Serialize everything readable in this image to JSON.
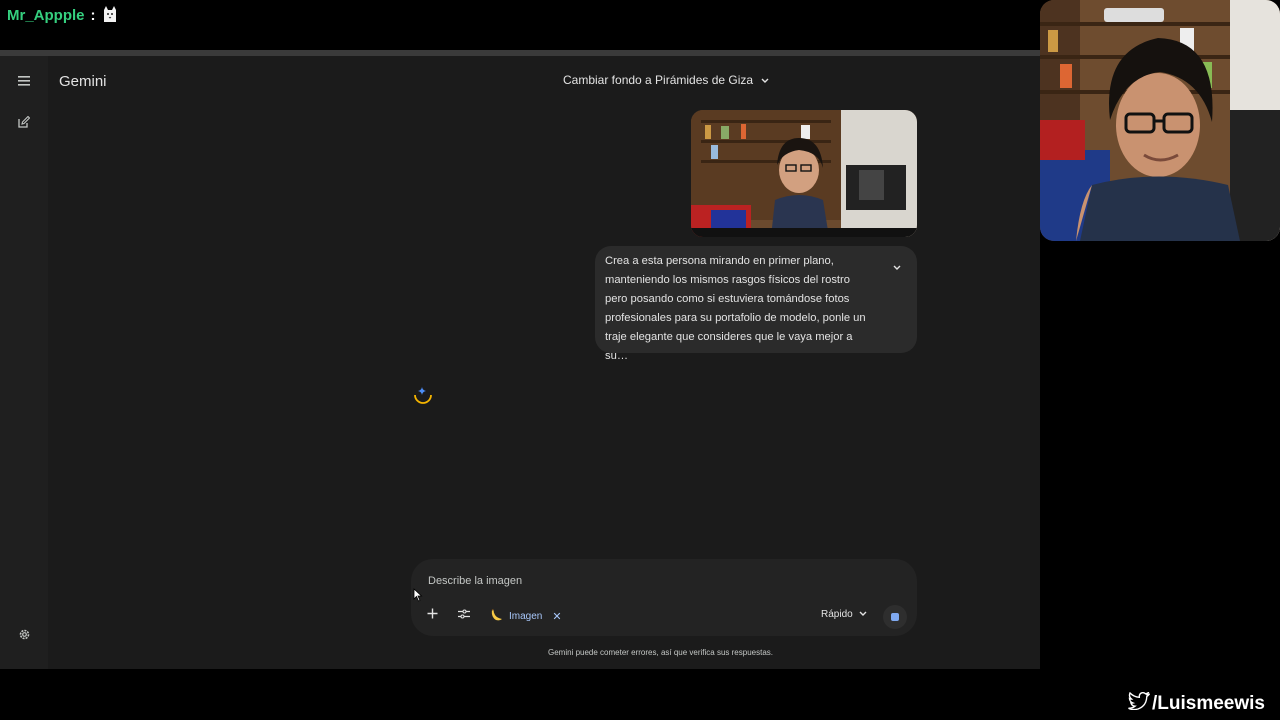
{
  "overlay": {
    "chat_user": "Mr_Appple",
    "chat_colon": ":",
    "social_handle": "/Luismeewis"
  },
  "app": {
    "brand": "Gemini",
    "conversation_title": "Cambiar fondo a Pirámides de Giza",
    "user_message": "Crea a esta persona mirando en primer plano, manteniendo los mismos rasgos físicos del rostro pero posando como si estuviera tomándose fotos profesionales para su portafolio de modelo, ponle un traje elegante que consideres que le vaya mejor a su…",
    "composer": {
      "placeholder": "Describe la imagen",
      "tool_chip_label": "Imagen",
      "model_label": "Rápido"
    },
    "disclaimer": "Gemini puede cometer errores, así que verifica sus respuestas."
  },
  "icons": {
    "menu": "menu-icon",
    "new_chat": "edit-icon",
    "settings": "gear-icon",
    "expand": "chevron-down-icon",
    "add": "plus-icon",
    "tools": "tune-icon",
    "banana": "banana-icon",
    "close": "close-icon",
    "stop": "stop-icon",
    "spinner": "gemini-spark-icon",
    "social": "twitter-icon"
  },
  "colors": {
    "chat_user": "#35d07f",
    "accent": "#a8c7fa",
    "app_bg": "#1b1b1b",
    "bubble_bg": "#2b2b2b"
  }
}
